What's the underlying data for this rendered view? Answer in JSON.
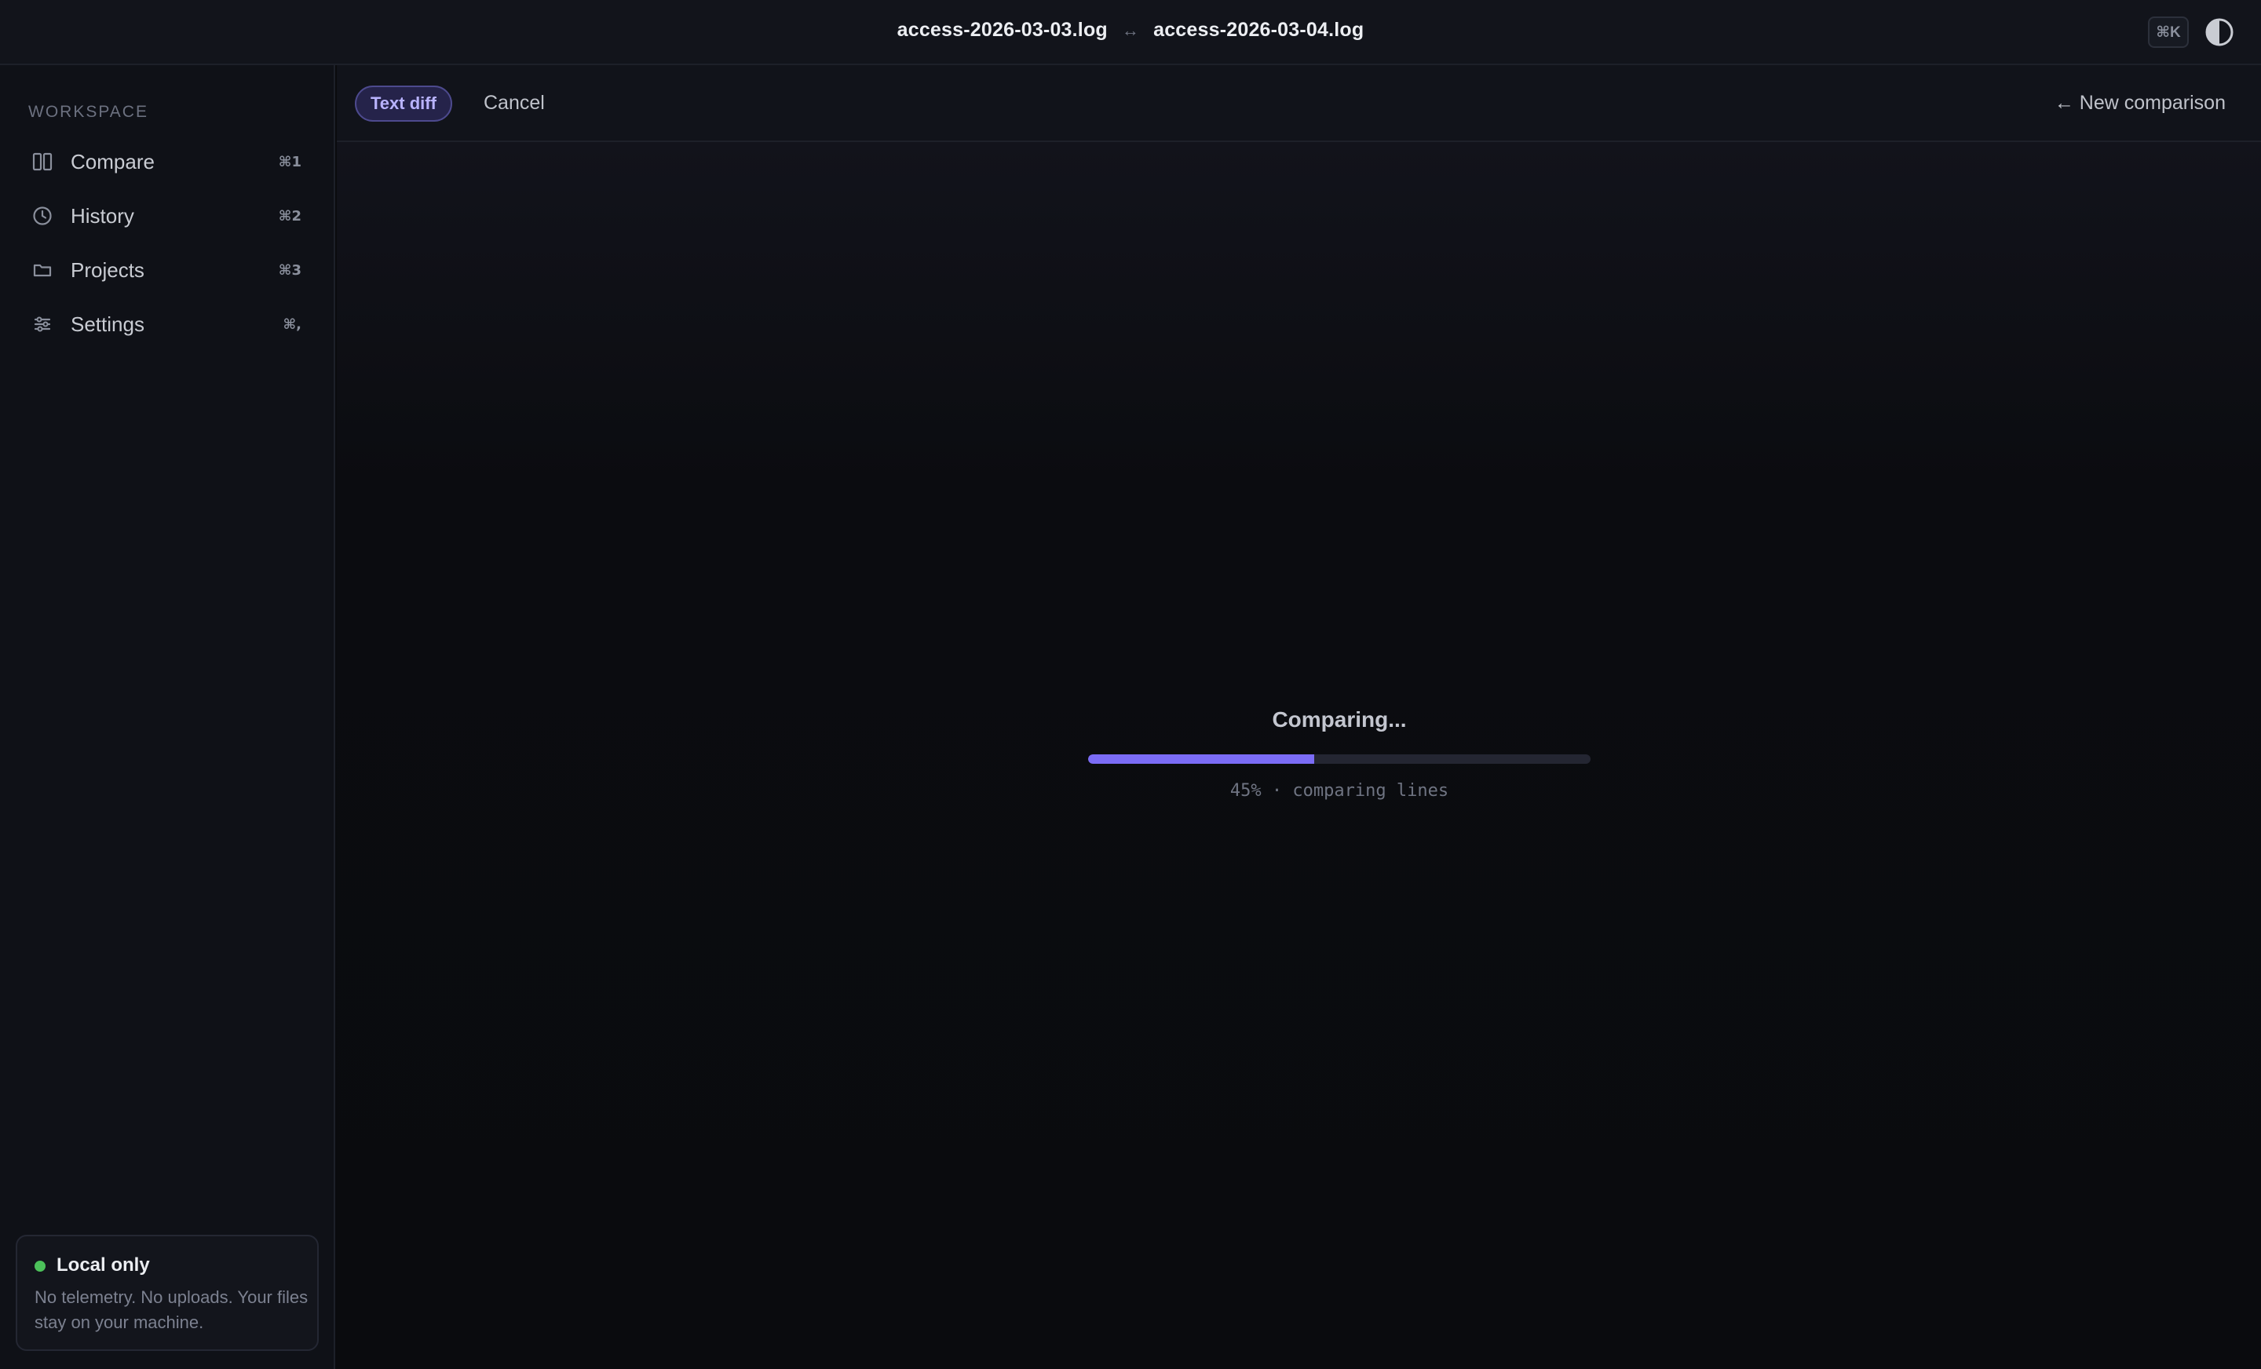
{
  "header": {
    "left_file": "access-2026-03-03.log",
    "arrow": "↔",
    "right_file": "access-2026-03-04.log",
    "shortcut_label": "⌘K",
    "theme_icon": "contrast-icon"
  },
  "sidebar": {
    "section_label": "WORKSPACE",
    "items": [
      {
        "label": "Compare",
        "shortcut": "⌘1",
        "icon": "columns-icon"
      },
      {
        "label": "History",
        "shortcut": "⌘2",
        "icon": "clock-icon"
      },
      {
        "label": "Projects",
        "shortcut": "⌘3",
        "icon": "folder-icon"
      },
      {
        "label": "Settings",
        "shortcut": "⌘,",
        "icon": "sliders-icon"
      }
    ],
    "local_box": {
      "title": "Local only",
      "body": "No telemetry. No uploads. Your files stay on your machine.",
      "status_color": "#4cc15a"
    }
  },
  "toolbar": {
    "mode_pill": "Text diff",
    "cancel_label": "Cancel",
    "new_comparison_label": "← New comparison"
  },
  "progress": {
    "title": "Comparing...",
    "percent": 45,
    "status": "45% · comparing lines",
    "accent": "#7b6cf6"
  }
}
